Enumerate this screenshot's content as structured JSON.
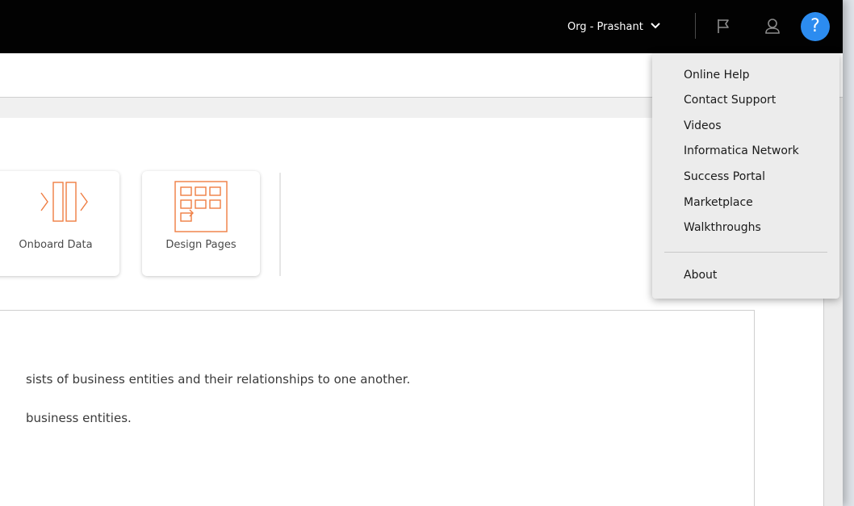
{
  "header": {
    "org_label": "Org - Prashant",
    "help_label": "?",
    "icons": [
      "chevron-down-icon",
      "flag-icon",
      "user-icon",
      "help-icon"
    ]
  },
  "tiles": [
    {
      "label": "Onboard Data",
      "icon": "onboard-data-icon"
    },
    {
      "label": "Design Pages",
      "icon": "design-pages-icon"
    }
  ],
  "content": {
    "line1": "sists of business entities and their relationships to one another.",
    "line2": " business entities."
  },
  "help_menu": {
    "items": [
      "Online Help",
      "Contact Support",
      "Videos",
      "Informatica Network",
      "Success Portal",
      "Marketplace",
      "Walkthroughs"
    ],
    "about": "About"
  },
  "colors": {
    "topbar": "#020202",
    "accent_blue": "#2c8cf0",
    "tile_icon_orange": "#ef7d42",
    "menu_bg": "#ececec"
  }
}
